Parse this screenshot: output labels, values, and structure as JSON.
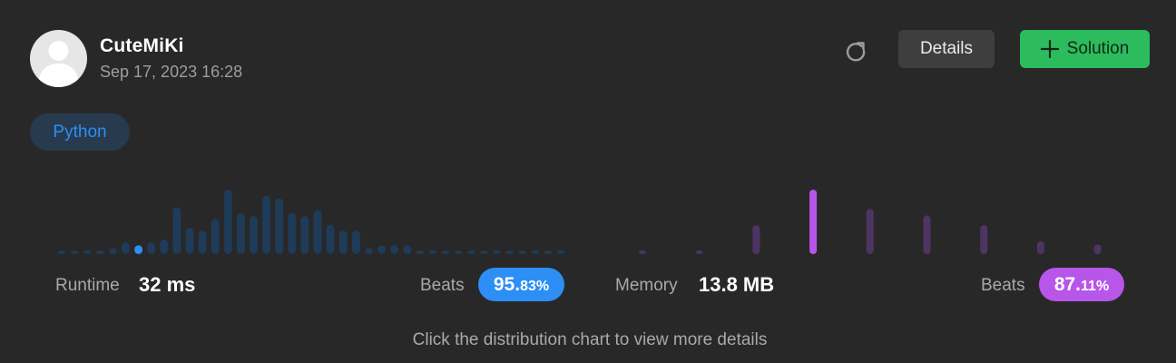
{
  "user": {
    "name": "CuteMiKi",
    "timestamp": "Sep 17, 2023 16:28",
    "avatar_icon": "default-user-avatar-icon"
  },
  "header": {
    "refresh_icon": "refresh-icon",
    "details_label": "Details",
    "solution_label": "Solution",
    "solution_icon": "plus-icon"
  },
  "language": {
    "label": "Python"
  },
  "runtime": {
    "label": "Runtime",
    "value": "32 ms",
    "beats_label": "Beats",
    "beats_whole": "95.",
    "beats_fraction": "83%"
  },
  "memory": {
    "label": "Memory",
    "value": "13.8 MB",
    "beats_label": "Beats",
    "beats_whole": "87.",
    "beats_fraction": "11%"
  },
  "hint": "Click the distribution chart to view more details",
  "colors": {
    "runtime_bar": "#1e3b58",
    "runtime_highlight": "#2d8ef5",
    "memory_bar": "#4e3462",
    "memory_highlight": "#b756e9"
  },
  "chart_data": [
    {
      "type": "bar",
      "name": "runtime-distribution",
      "highlight_index": 6,
      "values": [
        1,
        1,
        1,
        1,
        2,
        4,
        3,
        4,
        5,
        16,
        9,
        8,
        12,
        22,
        14,
        13,
        20,
        19,
        14,
        13,
        15,
        10,
        8,
        8,
        2,
        3,
        3,
        3,
        1,
        1,
        1,
        1,
        1,
        1,
        1,
        1,
        1,
        1,
        1,
        1
      ],
      "ylim": [
        0,
        22
      ]
    },
    {
      "type": "bar",
      "name": "memory-distribution",
      "highlight_index": 3,
      "values": [
        1,
        1,
        9,
        20,
        14,
        12,
        9,
        4,
        3
      ],
      "ylim": [
        0,
        20
      ]
    }
  ]
}
